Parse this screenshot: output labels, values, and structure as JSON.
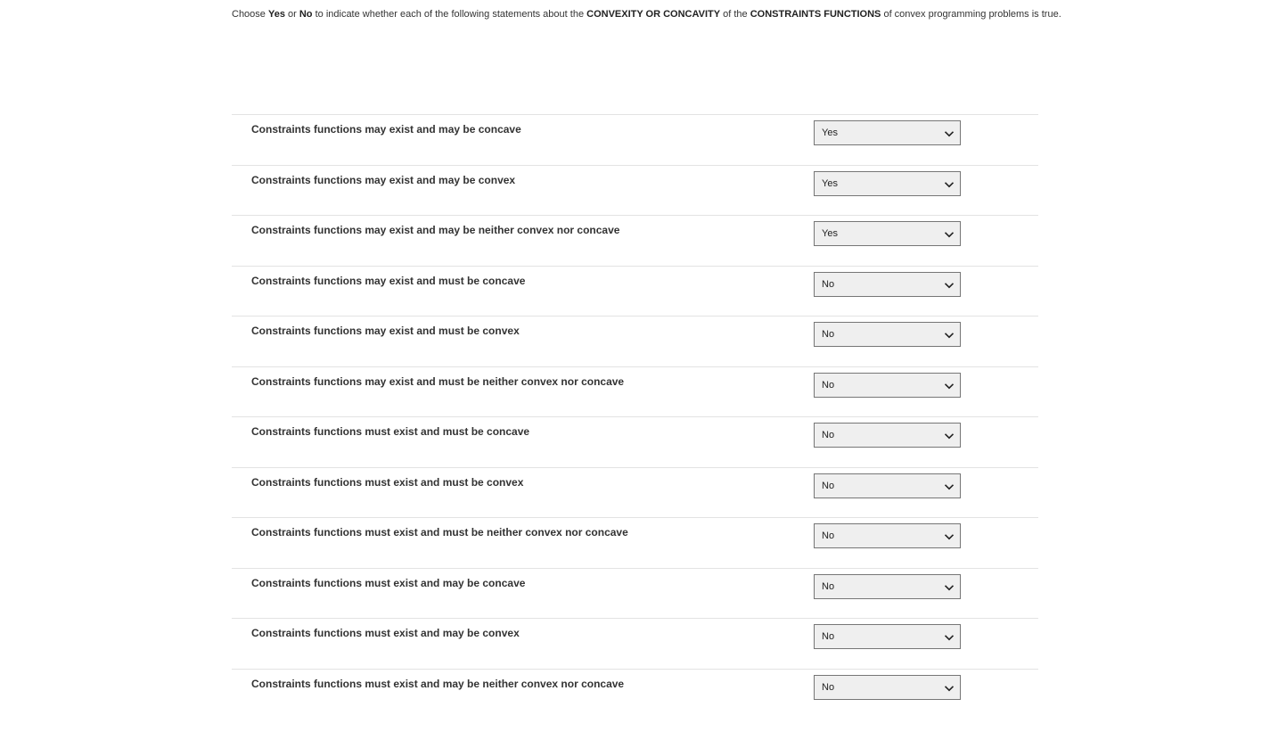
{
  "instructions": {
    "t1": "Choose ",
    "yes": "Yes",
    "t2": " or ",
    "no": "No",
    "t3": " to indicate whether each of the following statements about the ",
    "topic": "CONVEXITY OR CONCAVITY",
    "t4": " of the ",
    "subject": "CONSTRAINTS FUNCTIONS",
    "t5": " of convex programming problems is true."
  },
  "questions": [
    {
      "label": "Constraints functions may exist and may be concave",
      "value": "Yes"
    },
    {
      "label": "Constraints functions may exist and may be convex",
      "value": "Yes"
    },
    {
      "label": "Constraints functions may exist and may be neither convex nor concave",
      "value": "Yes"
    },
    {
      "label": "Constraints functions may exist and must be concave",
      "value": "No"
    },
    {
      "label": "Constraints functions may exist and must be convex",
      "value": "No"
    },
    {
      "label": "Constraints functions may exist and must be neither convex nor concave",
      "value": "No"
    },
    {
      "label": "Constraints functions must exist and must be concave",
      "value": "No"
    },
    {
      "label": "Constraints functions must exist and must be convex",
      "value": "No"
    },
    {
      "label": "Constraints functions must exist and must be neither convex nor concave",
      "value": "No"
    },
    {
      "label": "Constraints functions must exist and may be concave",
      "value": "No"
    },
    {
      "label": "Constraints functions must exist and may be convex",
      "value": "No"
    },
    {
      "label": "Constraints functions must exist and may be neither convex nor concave",
      "value": "No"
    }
  ],
  "icons": {
    "dropdown": "chevron-down-icon"
  }
}
